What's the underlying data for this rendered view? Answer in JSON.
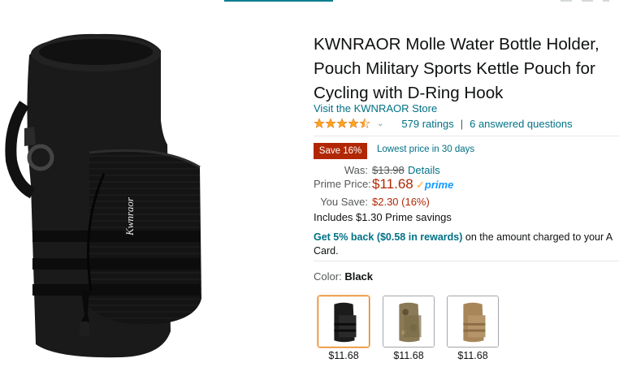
{
  "product": {
    "title_lines": [
      "KWNRAOR Molle Water Bottle Holder,",
      "Pouch Military Sports Kettle Pouch for",
      "Cycling with D-Ring Hook"
    ],
    "store_link": "Visit the KWNRAOR Store",
    "image_brand_text": "Kwnraor",
    "image_alt_icon": "product-image"
  },
  "rating": {
    "stars": 4.5,
    "ratings_text": "579 ratings",
    "separator": "|",
    "answered_text": "6 answered questions",
    "chevron": "⌄"
  },
  "deal": {
    "save_badge": "Save 16%",
    "lowest_text": "Lowest price in 30 days"
  },
  "price": {
    "was_label": "Was:",
    "was_value": "$13.98",
    "details_link": "Details",
    "prime_label": "Prime Price:",
    "prime_value": "$11.68",
    "prime_check": "✓",
    "prime_word": "prime",
    "yousave_label": "You Save:",
    "yousave_value": "$2.30 (16%)",
    "includes_text": "Includes $1.30 Prime savings"
  },
  "rewards": {
    "strong_text": "Get 5% back ($0.58 in rewards)",
    "rest_text": " on the amount charged to your A",
    "line2": "Card."
  },
  "color": {
    "label": "Color:",
    "selected": "Black",
    "options": [
      {
        "name": "Black",
        "price": "$11.68",
        "color": "#1b1b1b"
      },
      {
        "name": "Camo",
        "price": "$11.68",
        "color": "#8a7a55"
      },
      {
        "name": "Tan",
        "price": "$11.68",
        "color": "#a8865a"
      }
    ]
  },
  "colors": {
    "link": "#007185",
    "price_red": "#B12704",
    "prime_blue": "#1399ff",
    "star_orange": "#FFA41C",
    "selected_border": "#e77600"
  }
}
